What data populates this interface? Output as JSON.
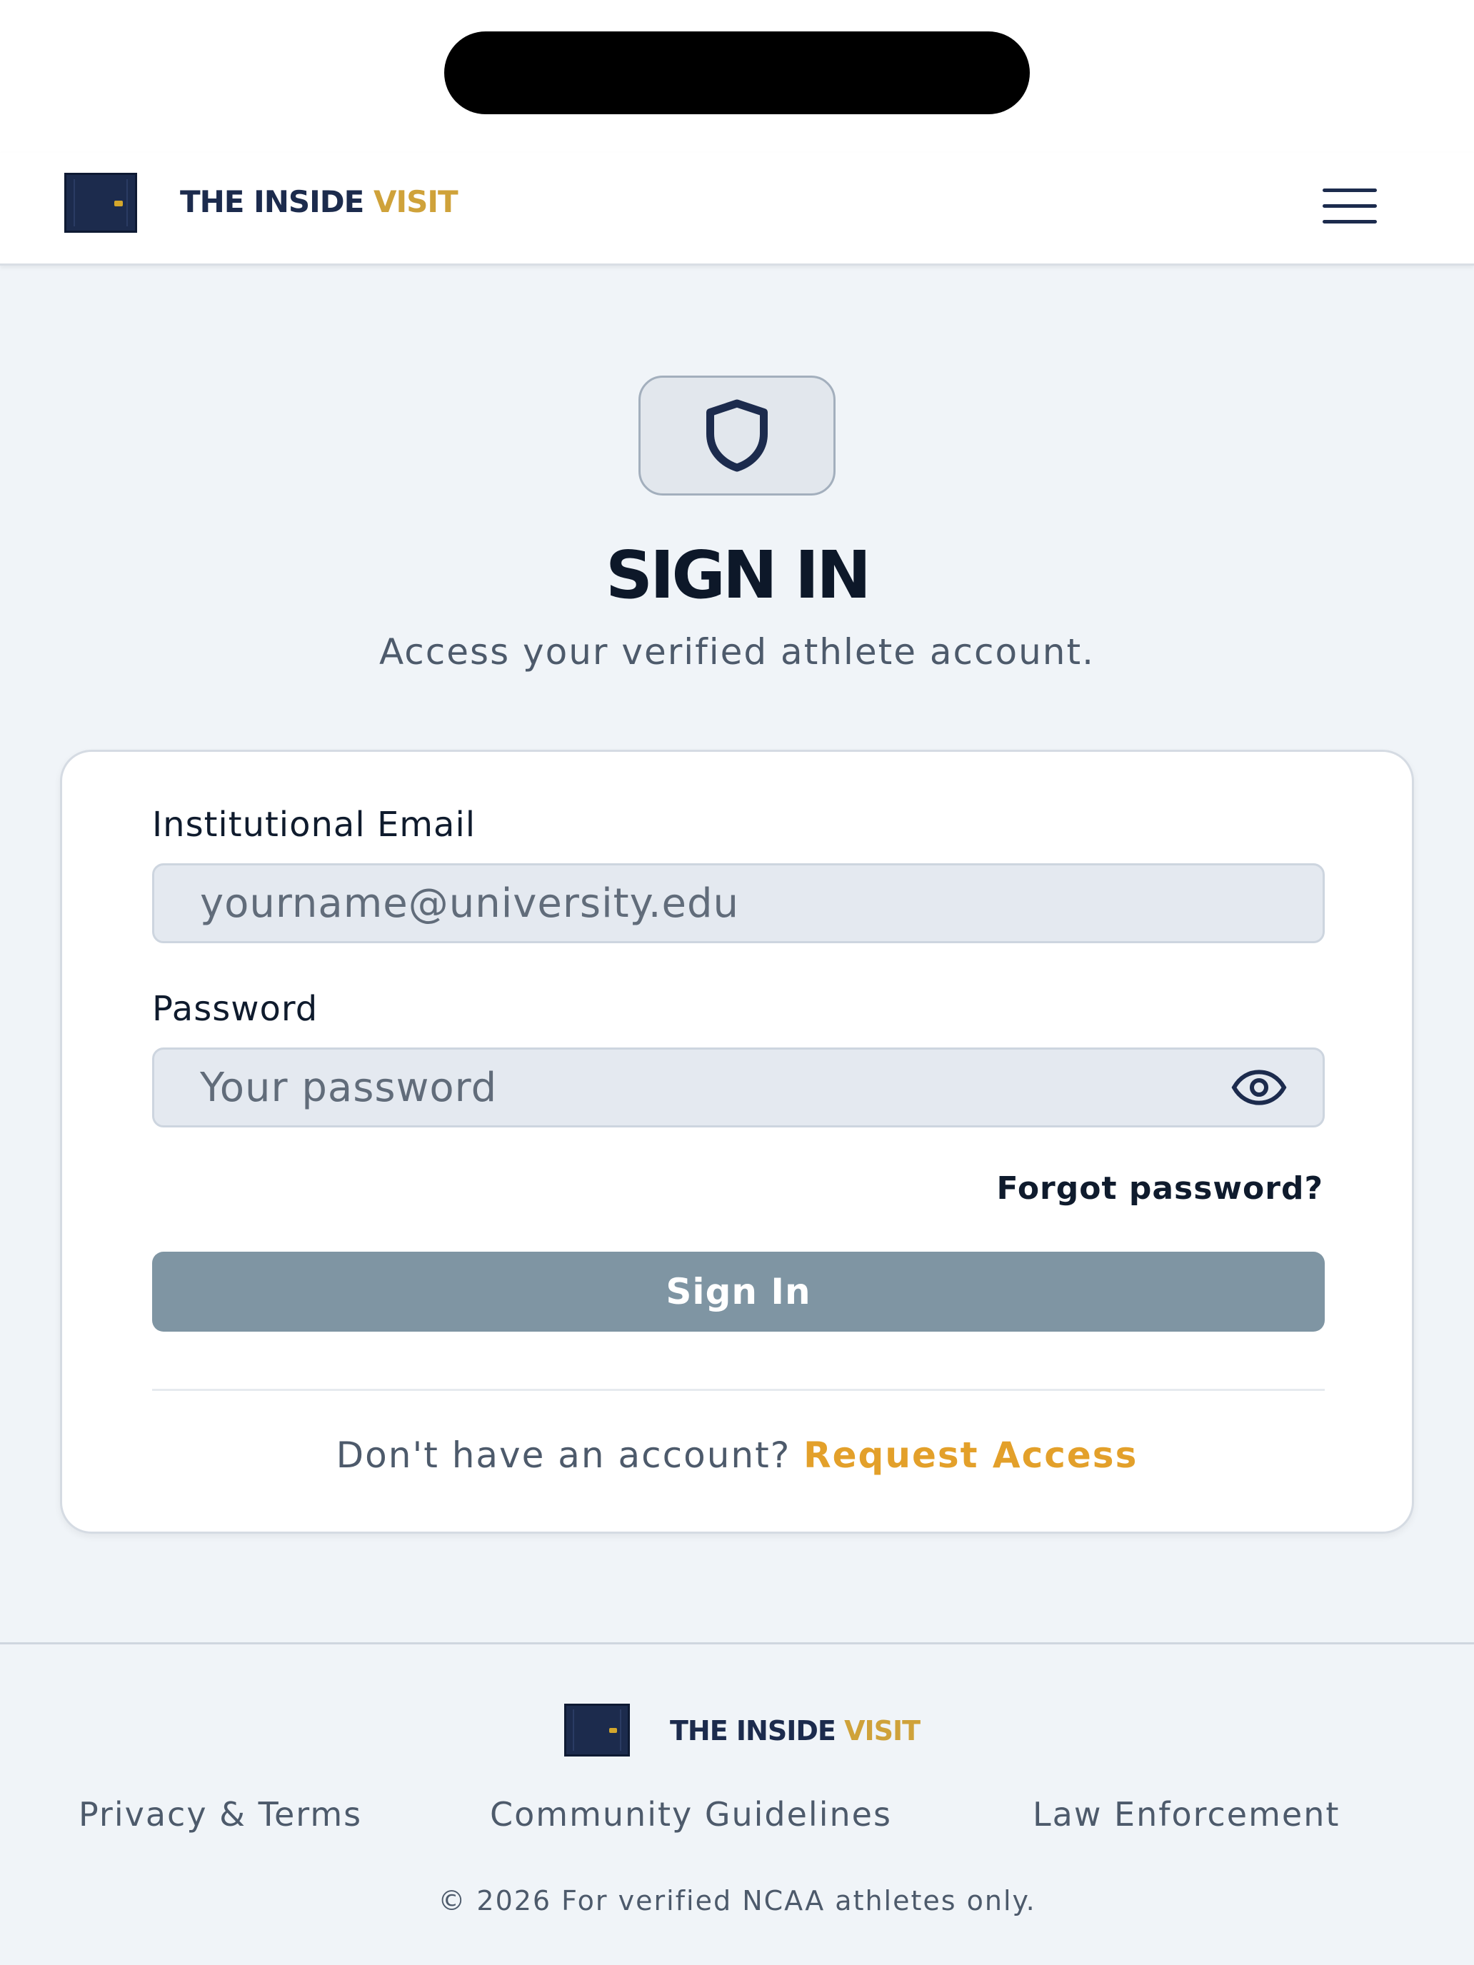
{
  "header": {
    "brand_primary": "THE INSIDE",
    "brand_accent": "VISIT",
    "menu_icon": "hamburger-icon"
  },
  "hero": {
    "icon": "shield-icon",
    "title": "SIGN IN",
    "subtitle": "Access your verified athlete account."
  },
  "form": {
    "email_label": "Institutional Email",
    "email_placeholder": "yourname@university.edu",
    "email_value": "",
    "password_label": "Password",
    "password_placeholder": "Your password",
    "password_value": "",
    "password_toggle_icon": "eye-icon",
    "forgot_label": "Forgot password?",
    "submit_label": "Sign In",
    "no_account_text": "Don't have an account?",
    "request_access_label": "Request Access"
  },
  "footer": {
    "brand_primary": "THE INSIDE",
    "brand_accent": "VISIT",
    "links": [
      "Privacy & Terms",
      "Community Guidelines",
      "Law Enforcement"
    ],
    "copyright": "© 2026 For verified NCAA athletes only."
  },
  "colors": {
    "brand_navy": "#1c2b4d",
    "brand_gold": "#cfa23a",
    "accent_orange": "#e3a02a",
    "button_disabled": "#7f95a3",
    "background": "#f0f4f8"
  }
}
